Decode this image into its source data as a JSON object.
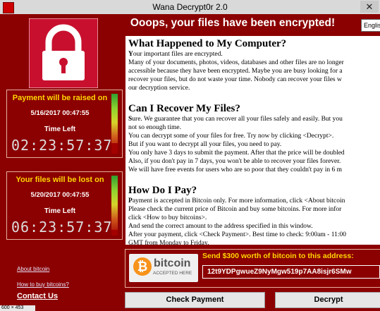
{
  "window": {
    "title": "Wana Decrypt0r 2.0",
    "close_glyph": "✕",
    "size_overlay": "600 × 453"
  },
  "heading": "Ooops, your files have been encrypted!",
  "language": "English",
  "colors": {
    "background": "#8b0000",
    "label": "#ffd700",
    "text": "#ffffff"
  },
  "timers": [
    {
      "label": "Payment will be raised on",
      "date": "5/16/2017 00:47:55",
      "time_left_label": "Time Left",
      "countdown": "02:23:57:37",
      "elapsed_fraction": 0.18
    },
    {
      "label": "Your files will be lost on",
      "date": "5/20/2017 00:47:55",
      "time_left_label": "Time Left",
      "countdown": "06:23:57:37",
      "elapsed_fraction": 0.1
    }
  ],
  "links": {
    "about_bitcoin": "About bitcoin",
    "how_to_buy": "How to buy bitcoins?",
    "contact": "Contact Us"
  },
  "content": {
    "sections": [
      {
        "title": "What Happened to My Computer?",
        "lines": [
          "Your important files are encrypted.",
          "Many of your documents, photos, videos, databases and other files are no longer",
          "accessible because they have been encrypted. Maybe you are busy looking for a",
          "recover your files, but do not waste your time. Nobody can recover your files w",
          "our decryption service."
        ]
      },
      {
        "title": "Can I Recover My Files?",
        "lines": [
          "Sure. We guarantee that you can recover all your files safely and easily. But you",
          "not so enough time.",
          "You can decrypt some of your files for free. Try now by clicking <Decrypt>.",
          "But if you want to decrypt all your files, you need to pay.",
          "You only have 3 days to submit the payment. After that the price will be doubled",
          "Also, if you don't pay in 7 days, you won't be able to recover your files forever.",
          "We will have free events for users who are so poor that they couldn't pay in 6 m"
        ]
      },
      {
        "title": "How Do I Pay?",
        "lines": [
          "Payment is accepted in Bitcoin only. For more information, click <About bitcoin",
          "Please check the current price of Bitcoin and buy some bitcoins. For more infor",
          "click <How to buy bitcoins>.",
          "And send the correct amount to the address specified in this window.",
          "After your payment, click <Check Payment>. Best time to check: 9:00am - 11:00",
          "GMT from Monday to Friday."
        ]
      }
    ]
  },
  "payment": {
    "bitcoin_logo_text": "bitcoin",
    "bitcoin_logo_glyph": "₿",
    "accepted_text": "ACCEPTED HERE",
    "send_label": "Send $300 worth of bitcoin to this address:",
    "address": "12t9YDPgwueZ9NyMgw519p7AA8isjr6SMw"
  },
  "buttons": {
    "check_payment": "Check Payment",
    "decrypt": "Decrypt"
  }
}
